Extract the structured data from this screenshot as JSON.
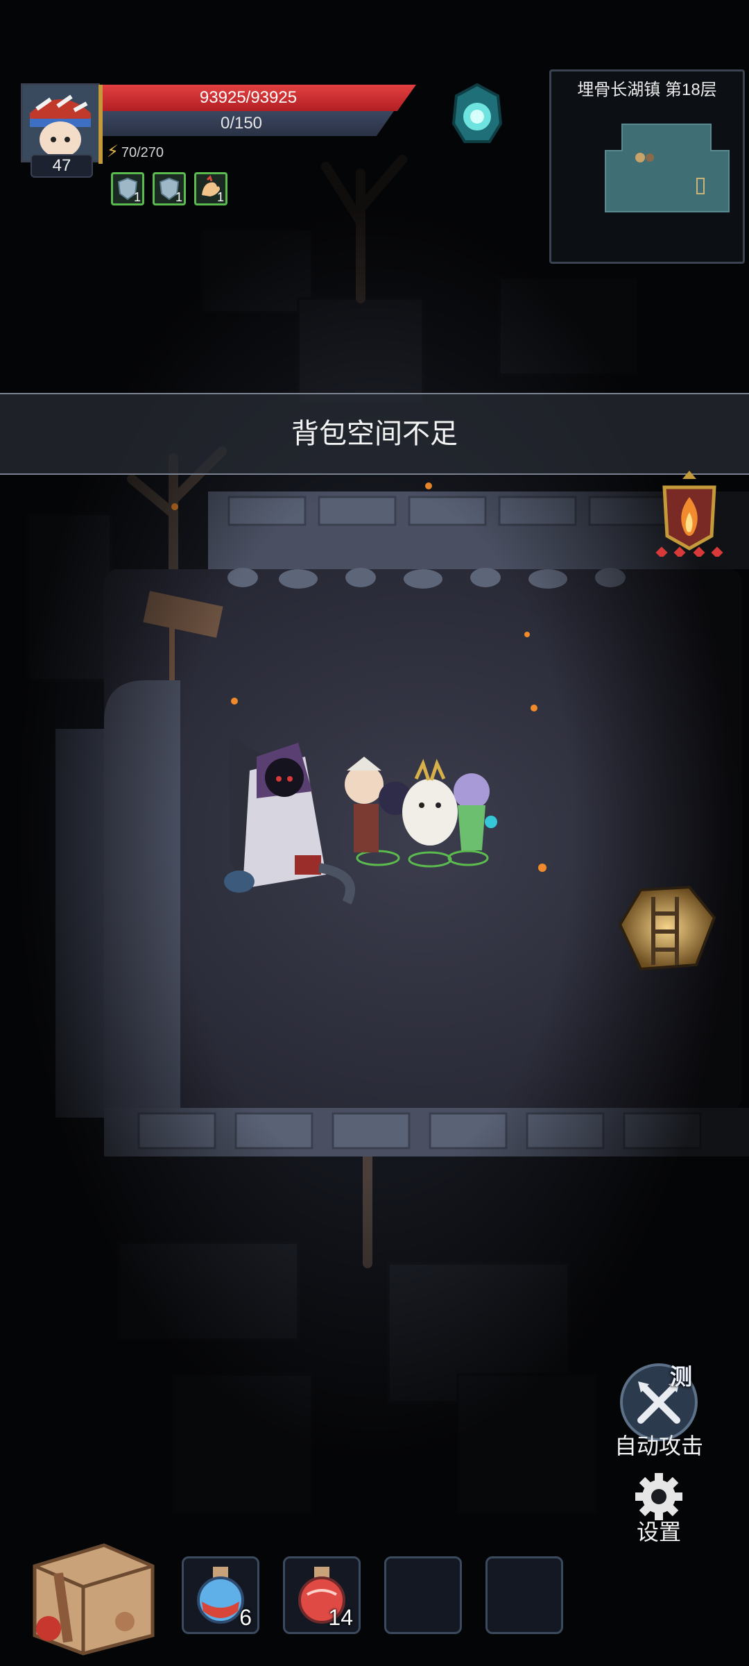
{
  "hud": {
    "level": "47",
    "hp": "93925/93925",
    "mp": "0/150",
    "energy": "70/270",
    "buffs": [
      {
        "icon": "shield-buff-icon",
        "count": "1"
      },
      {
        "icon": "shield-buff-icon",
        "count": "1"
      },
      {
        "icon": "strength-buff-icon",
        "count": "1"
      }
    ]
  },
  "minimap": {
    "title": "埋骨长湖镇 第18层"
  },
  "toast": {
    "message": "背包空间不足"
  },
  "controls": {
    "auto_attack_label": "自动攻击",
    "test_badge": "测",
    "settings_label": "设置"
  },
  "inventory": {
    "bag_icon": "backpack-icon",
    "slots": [
      {
        "icon": "blue-potion-icon",
        "count": "6"
      },
      {
        "icon": "red-potion-icon",
        "count": "14"
      },
      {
        "icon": "",
        "count": ""
      },
      {
        "icon": "",
        "count": ""
      }
    ]
  },
  "colors": {
    "hp": "#d8363b",
    "mp": "#323b52",
    "buff_border": "#5cbb4e",
    "minimap_room": "#3f6e74"
  }
}
